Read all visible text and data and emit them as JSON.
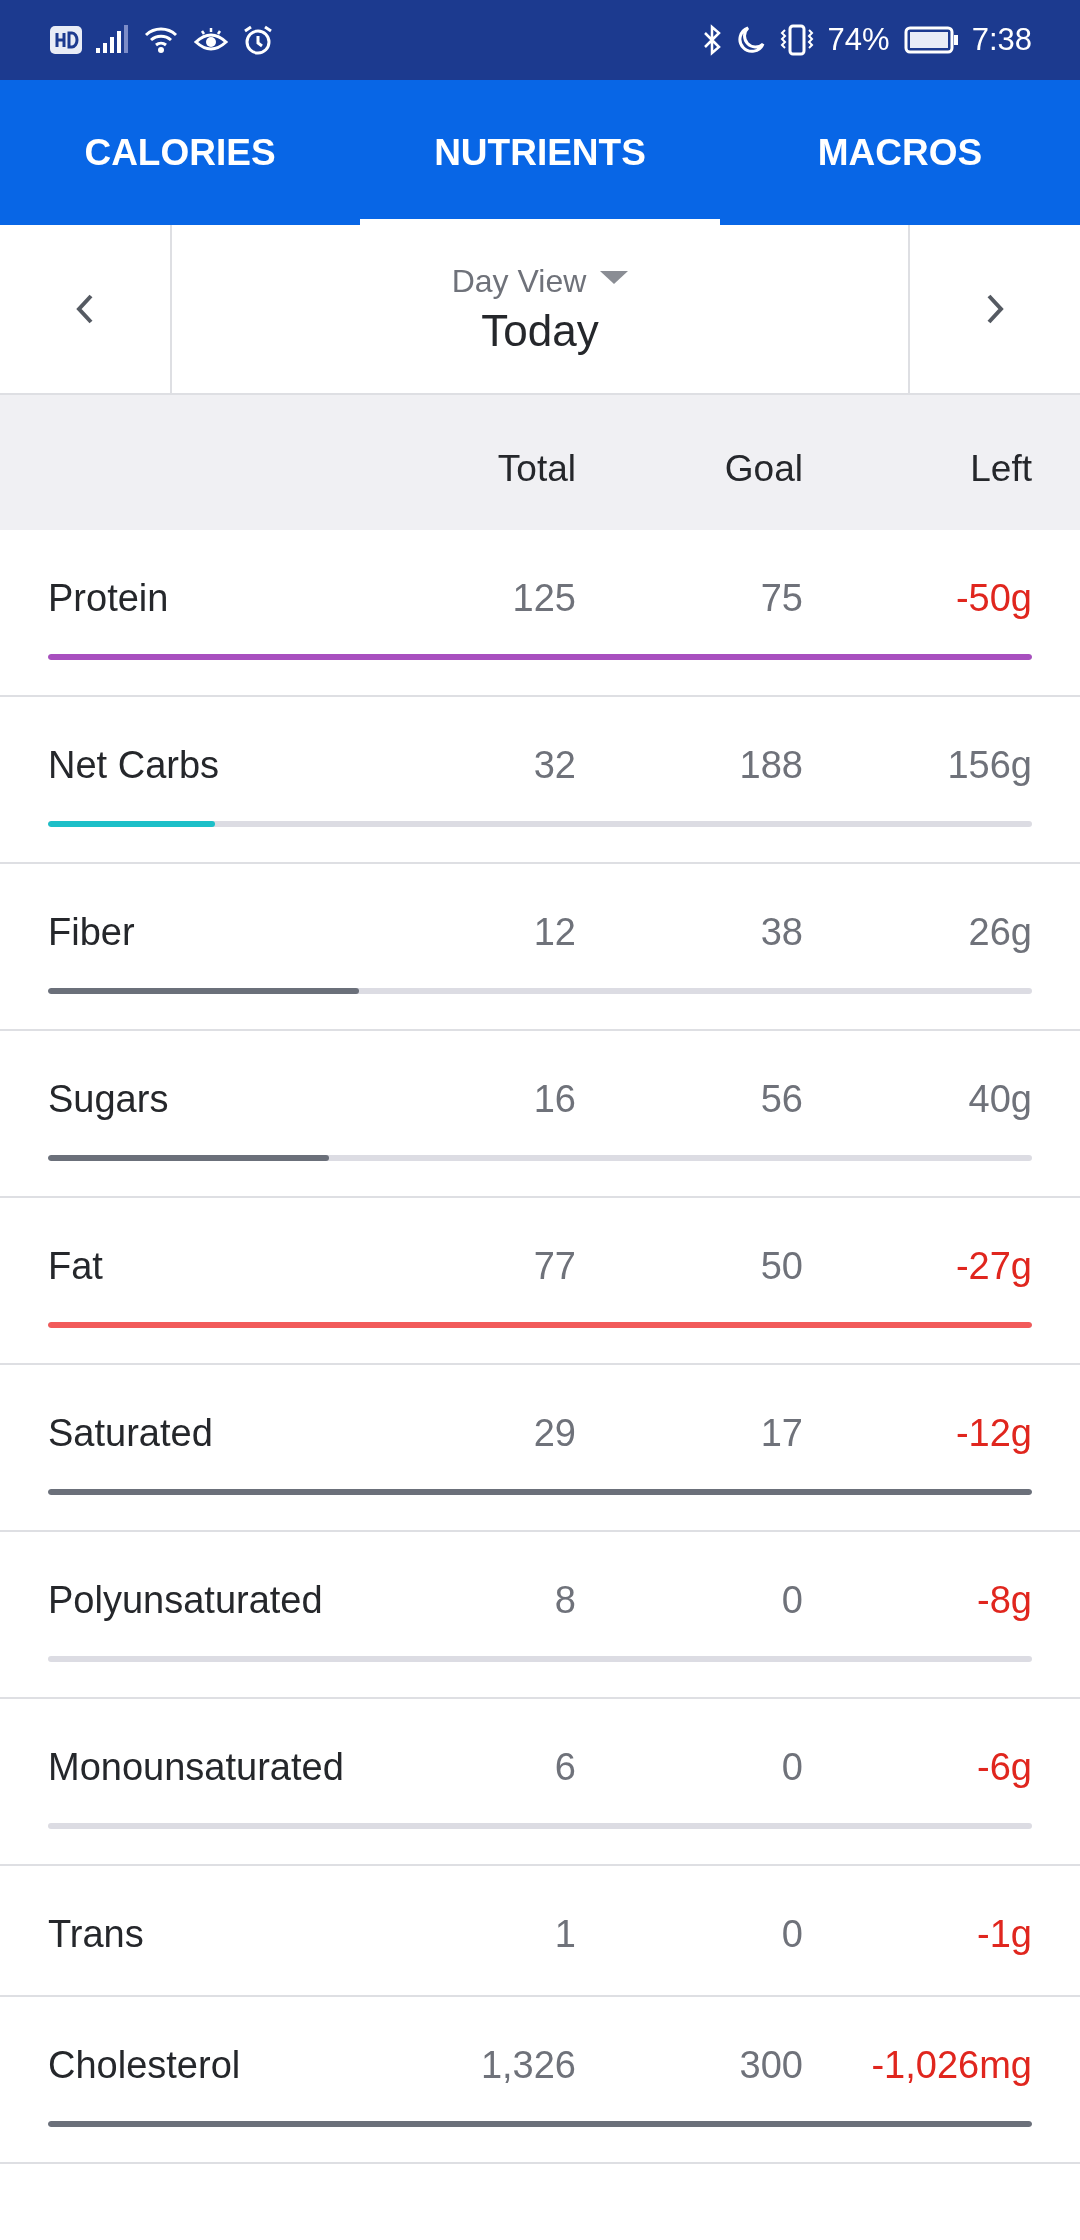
{
  "status_bar": {
    "battery": "74%",
    "time": "7:38"
  },
  "tabs": [
    {
      "label": "CALORIES",
      "selected": false
    },
    {
      "label": "NUTRIENTS",
      "selected": true
    },
    {
      "label": "MACROS",
      "selected": false
    }
  ],
  "day_nav": {
    "mode": "Day View",
    "date": "Today"
  },
  "columns": [
    "Total",
    "Goal",
    "Left"
  ],
  "rows": [
    {
      "name": "Protein",
      "total": "125",
      "goal": "75",
      "left": "-50g",
      "over": true,
      "level": 1,
      "color": "#a84fbf"
    },
    {
      "name": "Net Carbs",
      "total": "32",
      "goal": "188",
      "left": "156g",
      "over": false,
      "level": 0.17,
      "color": "#1dbfc8"
    },
    {
      "name": "Fiber",
      "total": "12",
      "goal": "38",
      "left": "26g",
      "over": false,
      "level": 0.316,
      "color": "#6b707a"
    },
    {
      "name": "Sugars",
      "total": "16",
      "goal": "56",
      "left": "40g",
      "over": false,
      "level": 0.286,
      "color": "#6b707a"
    },
    {
      "name": "Fat",
      "total": "77",
      "goal": "50",
      "left": "-27g",
      "over": true,
      "level": 1,
      "color": "#f25a5a"
    },
    {
      "name": "Saturated",
      "total": "29",
      "goal": "17",
      "left": "-12g",
      "over": true,
      "level": 1,
      "color": "#6b707a"
    },
    {
      "name": "Polyunsaturated",
      "total": "8",
      "goal": "0",
      "left": "-8g",
      "over": true,
      "kind": "bar"
    },
    {
      "name": "Monounsaturated",
      "total": "6",
      "goal": "0",
      "left": "-6g",
      "over": true,
      "kind": "bar"
    },
    {
      "name": "Trans",
      "total": "1",
      "goal": "0",
      "left": "-1g",
      "over": true,
      "kind": "plain"
    },
    {
      "name": "Cholesterol",
      "total": "1,326",
      "goal": "300",
      "left": "-1,026mg",
      "over": true,
      "level": 1,
      "color": "#6b707a"
    }
  ]
}
